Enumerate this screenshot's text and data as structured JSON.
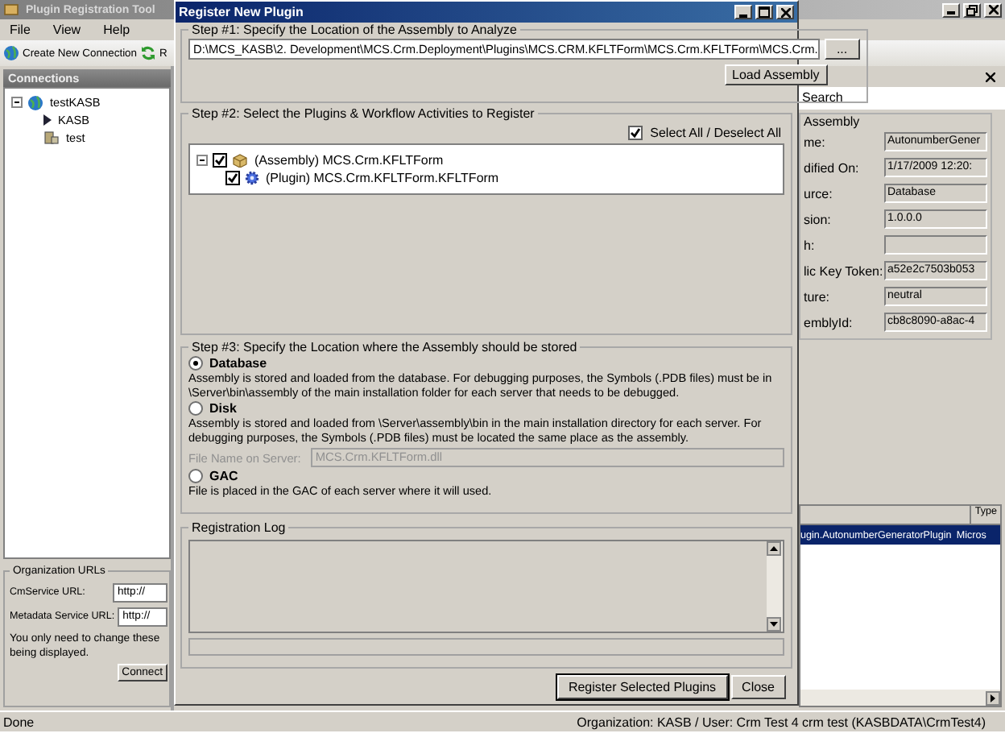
{
  "main_window": {
    "title": "Plugin Registration Tool",
    "menu": [
      "File",
      "View",
      "Help"
    ],
    "toolbar": [
      {
        "label": "Create New Connection",
        "kind": "globe"
      },
      {
        "label": "R",
        "kind": "refresh"
      }
    ],
    "connections": {
      "title": "Connections",
      "tree": [
        {
          "label": "testKASB",
          "kind": "globe",
          "expanded": true,
          "children": [
            {
              "label": "KASB",
              "kind": "arrow"
            },
            {
              "label": "test",
              "kind": "server"
            }
          ]
        }
      ]
    },
    "organization_urls": {
      "title": "Organization URLs",
      "fields": [
        {
          "label": "CmService URL:",
          "value": "http://"
        },
        {
          "label": "Metadata Service URL:",
          "value": "http://"
        }
      ],
      "note": [
        "You only need to change these",
        "being displayed."
      ],
      "button": "Connect"
    },
    "details": {
      "tab": "Search",
      "group": "Assembly",
      "fields": [
        {
          "label": "me:",
          "value": "AutonumberGener"
        },
        {
          "label": "dified On:",
          "value": "1/17/2009 12:20:"
        },
        {
          "label": "urce:",
          "value": "Database"
        },
        {
          "label": "sion:",
          "value": "1.0.0.0"
        },
        {
          "label": "h:"
        },
        {
          "label": "lic Key Token:",
          "value": "a52e2c7503b053"
        },
        {
          "label": "ture:",
          "value": "neutral"
        },
        {
          "label": "emblyId:",
          "value": "cb8c8090-a8ac-4"
        }
      ]
    },
    "list": {
      "columns": [
        "Type"
      ],
      "rows": [
        {
          "cells": [
            "ugin.AutonumberGeneratorPlugin",
            "Micros"
          ],
          "selected": true
        }
      ]
    },
    "status_bar": {
      "left": "Done",
      "right": "Organization: KASB / User: Crm Test 4 crm test (KASBDATA\\CrmTest4)"
    }
  },
  "dialog": {
    "title": "Register New Plugin",
    "step1": {
      "title": "Step #1: Specify the Location of the Assembly to Analyze",
      "path": "D:\\MCS_KASB\\2. Development\\MCS.Crm.Deployment\\Plugins\\MCS.CRM.KFLTForm\\MCS.Crm.KFLTForm\\MCS.Crm.",
      "browse": "...",
      "load": "Load Assembly"
    },
    "step2": {
      "title": "Step #2: Select the Plugins & Workflow Activities to Register",
      "select_all": {
        "label": "Select All / Deselect All",
        "checked": true
      },
      "tree": [
        {
          "label": "(Assembly) MCS.Crm.KFLTForm",
          "kind": "assembly",
          "checked": true,
          "expanded": true,
          "children": [
            {
              "label": "(Plugin) MCS.Crm.KFLTForm.KFLTForm",
              "kind": "plugin",
              "checked": true
            }
          ]
        }
      ]
    },
    "step3": {
      "title": "Step #3: Specify the Location where the Assembly should be stored",
      "options": [
        {
          "label": "Database",
          "selected": true,
          "description": "Assembly is stored and loaded from the database. For debugging purposes, the Symbols (.PDB files) must be in \\Server\\bin\\assembly of the main installation folder for each server that needs to be debugged."
        },
        {
          "label": "Disk",
          "selected": false,
          "description": "Assembly is stored and loaded from \\Server\\assembly\\bin in the main installation directory for each server. For debugging purposes, the Symbols (.PDB files) must be located the same place as the assembly.",
          "file_field": {
            "label": "File Name on Server:",
            "value": "MCS.Crm.KFLTForm.dll",
            "disabled": true
          }
        },
        {
          "label": "GAC",
          "selected": false,
          "description": "File is placed in the GAC of each server where it will used."
        }
      ]
    },
    "log": {
      "title": "Registration Log"
    },
    "buttons": [
      "Register Selected Plugins",
      "Close"
    ]
  }
}
